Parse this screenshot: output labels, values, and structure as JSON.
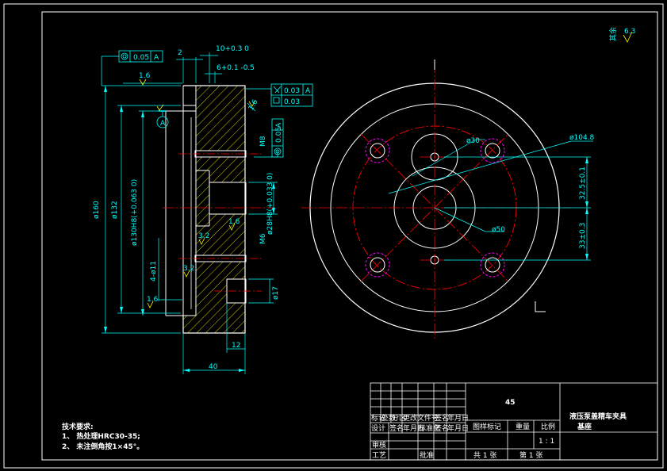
{
  "drawing": {
    "title_main": "液压泵盖精车夹具",
    "title_sub": "基座",
    "material": "45",
    "scale": "1 : 1",
    "sheet_total": "共 1 张",
    "sheet_no": "第 1 张",
    "roughness_corner": "6.3",
    "roughness_corner_prefix": "其余"
  },
  "title_block": {
    "row_labels": [
      "标记",
      "处数",
      "分区",
      "更改文件号",
      "签名",
      "年月日"
    ],
    "design_row": [
      "设计",
      "签名",
      "年月日",
      "标准化",
      "签名",
      "年月日"
    ],
    "headers": [
      "图样标记",
      "重量",
      "比例"
    ],
    "review": "审核",
    "process": "工艺",
    "approve": "批准"
  },
  "notes": {
    "heading": "技术要求:",
    "line1": "1、 热处理HRC30-35;",
    "line2": "2、 未注倒角按1×45°。"
  },
  "dimensions": {
    "d160": "ø160",
    "d132": "ø132",
    "d130": "ø130H8(+0.063 0)",
    "d28": "ø28H8(+0.033 0)",
    "d17": "ø17",
    "d11": "4-ø11",
    "m8": "M8",
    "m6": "M6",
    "w40": "40",
    "w12": "12",
    "w2": "2",
    "w10": "10+0.3 0",
    "w6": "6+0.1 -0.5",
    "r16a": "1.6",
    "r16b": "1.6",
    "r16c": "1.6",
    "r32a": "3.2",
    "r32b": "3.2",
    "r16d": "1.6",
    "datum": "A",
    "gt_conc_val": "0.05",
    "gt_conc_ref": "A",
    "gt_par_val": "0.03",
    "gt_par_ref": "A",
    "gt_flat_val": "0.03",
    "gt_side_val": "0.05",
    "gt_side_ref": "A",
    "d30": "ø30",
    "d104": "ø104.8",
    "d50": "ø50",
    "v325": "32.5±0.1",
    "v33": "33±0.3"
  }
}
